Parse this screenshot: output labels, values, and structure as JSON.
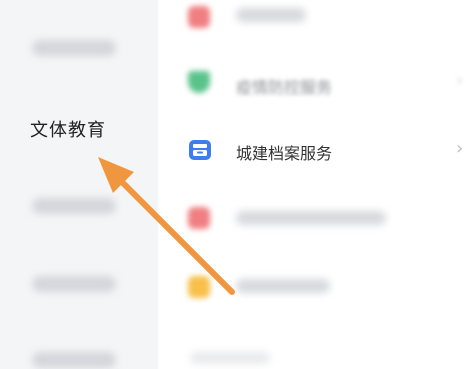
{
  "left_nav": {
    "active_item_label": "文体教育"
  },
  "right_list": {
    "rows": [
      {
        "label": "",
        "icon": "blurred-red-icon"
      },
      {
        "label": "疫情防控服务",
        "icon": "shield-icon"
      },
      {
        "label": "城建档案服务",
        "icon": "archive-box-icon"
      },
      {
        "label": "",
        "icon": "blurred-red-icon"
      },
      {
        "label": "",
        "icon": "blurred-yellow-icon"
      }
    ],
    "chevron": "›"
  },
  "colors": {
    "arrow": "#f0963f",
    "archive_icon": "#3d7df0",
    "shield_icon": "#59c38a",
    "red_icon": "#f07f82",
    "yellow_icon": "#f8c04a"
  }
}
